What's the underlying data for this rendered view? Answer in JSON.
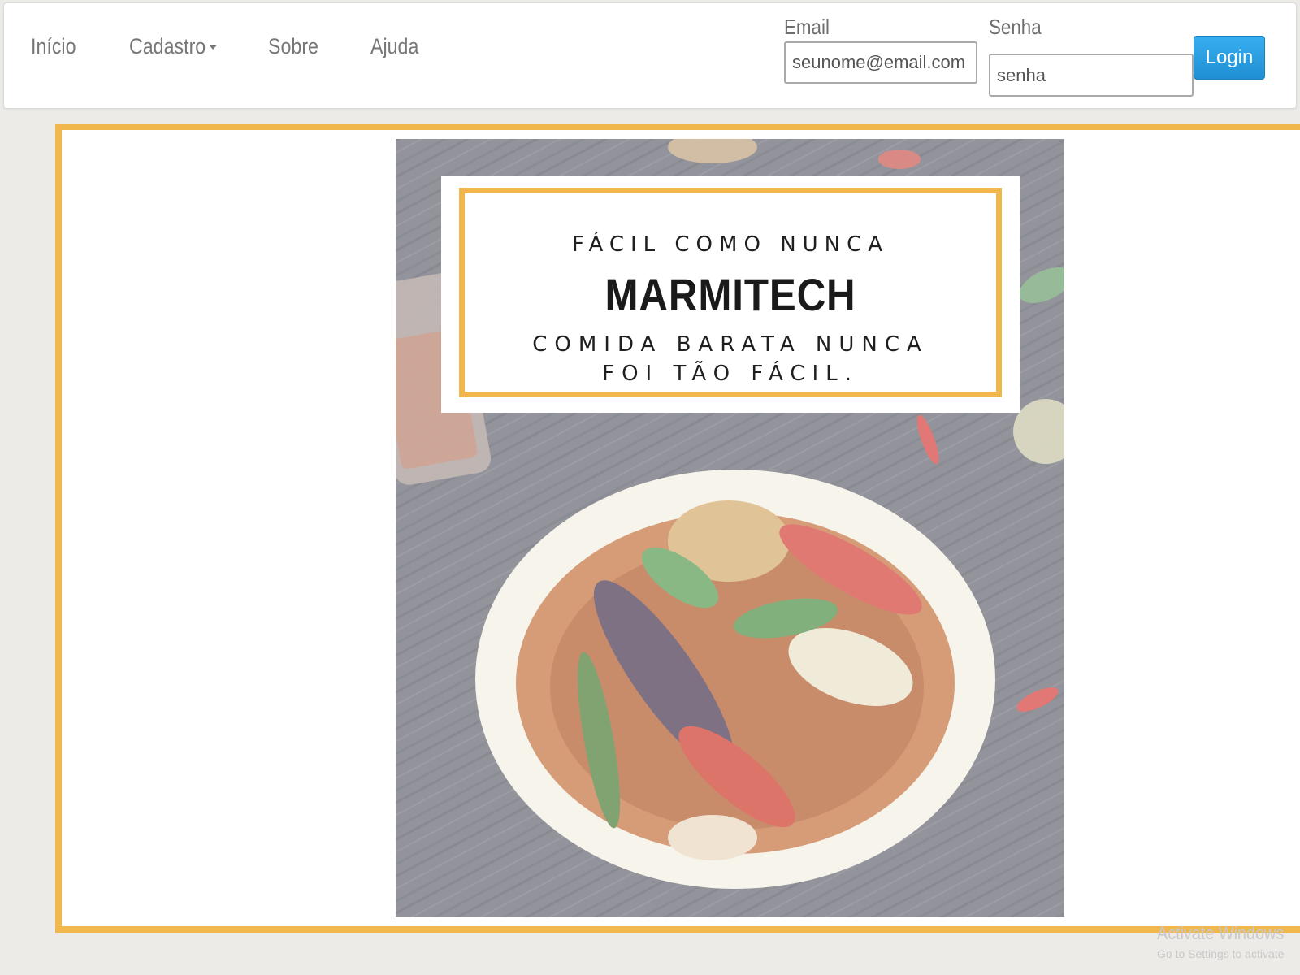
{
  "nav": {
    "items": [
      {
        "label": "Início"
      },
      {
        "label": "Cadastro"
      },
      {
        "label": "Sobre"
      },
      {
        "label": "Ajuda"
      }
    ]
  },
  "login_form": {
    "email_label": "Email",
    "email_value": "seunome@email.com",
    "password_label": "Senha",
    "password_value": "senha",
    "login_button": "Login"
  },
  "poster": {
    "tagline": "FÁCIL COMO NUNCA",
    "brand": "MARMITECH",
    "slogan_line1": "COMIDA BARATA NUNCA",
    "slogan_line2": "FOI TÃO FÁCIL."
  },
  "watermark": {
    "title": "Activate Windows",
    "subtitle": "Go to Settings to activate"
  },
  "colors": {
    "accent_border": "#f0b74c",
    "login_button": "#1f8fd2",
    "nav_text": "#777777"
  }
}
